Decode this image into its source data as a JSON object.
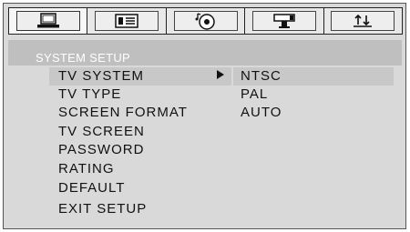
{
  "tabs": [
    {
      "icon": "monitor-icon",
      "active": true
    },
    {
      "icon": "keypad-icon",
      "active": false
    },
    {
      "icon": "disc-icon",
      "active": false
    },
    {
      "icon": "speaker-icon",
      "active": false
    },
    {
      "icon": "sort-icon",
      "active": false
    }
  ],
  "header": {
    "title": "SYSTEM SETUP"
  },
  "menu": {
    "items": [
      {
        "label": "TV SYSTEM",
        "selected": true
      },
      {
        "label": "TV TYPE"
      },
      {
        "label": "SCREEN FORMAT"
      },
      {
        "label": "TV SCREEN"
      },
      {
        "label": "PASSWORD"
      },
      {
        "label": "RATING"
      },
      {
        "label": "DEFAULT"
      },
      {
        "label": "EXIT SETUP"
      }
    ]
  },
  "submenu": {
    "options": [
      {
        "label": "NTSC",
        "selected": true
      },
      {
        "label": "PAL"
      },
      {
        "label": "AUTO"
      }
    ]
  }
}
